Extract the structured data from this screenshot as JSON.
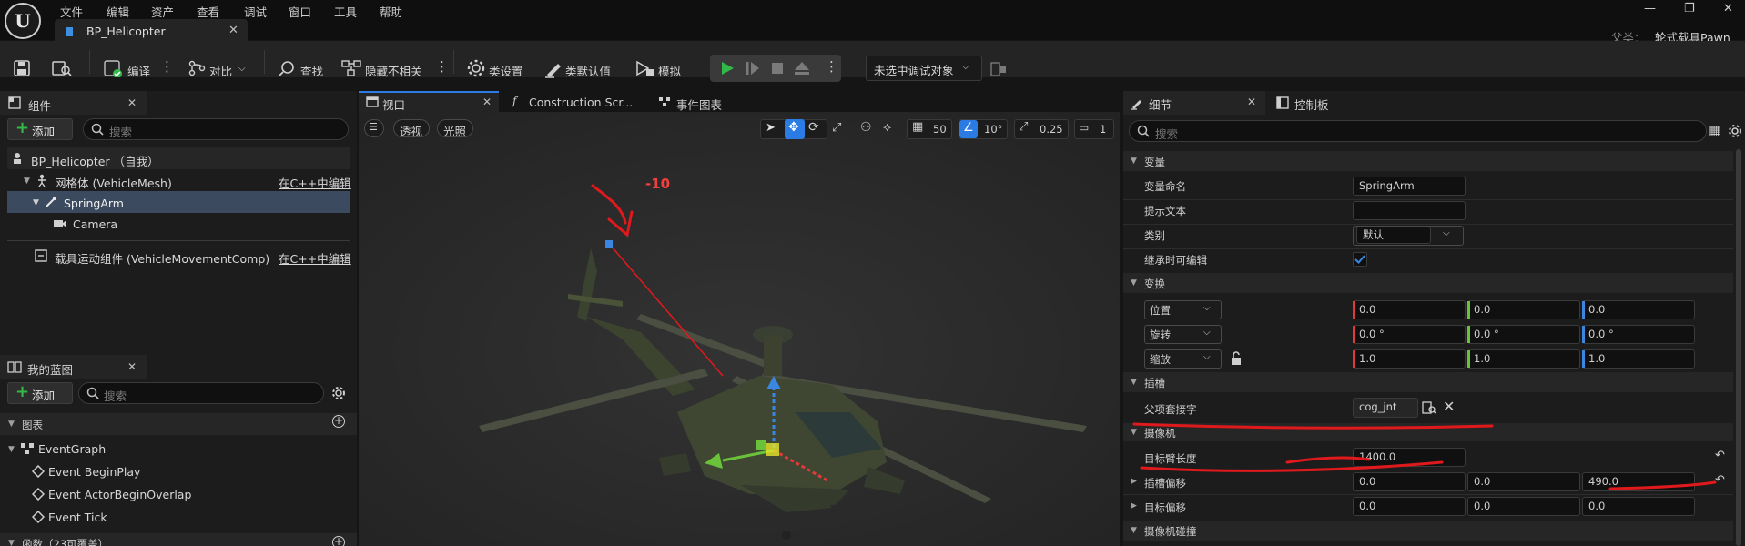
{
  "app": {
    "menu": [
      "文件",
      "编辑",
      "资产",
      "查看",
      "调试",
      "窗口",
      "工具",
      "帮助"
    ],
    "tab_title": "BP_Helicopter",
    "tab_close": "✕",
    "parent_label": "父类：",
    "parent_value": "轮式载具Pawn",
    "window_controls": [
      "—",
      "❐",
      "✕"
    ]
  },
  "toolbar": {
    "compile": "编译",
    "diff": "对比",
    "find": "查找",
    "hide_unrelated": "隐藏不相关",
    "class_settings": "类设置",
    "class_defaults": "类默认值",
    "simulate": "模拟",
    "debug_target": "未选中调试对象"
  },
  "components_panel": {
    "title": "组件",
    "add": "添加",
    "search_placeholder": "搜索",
    "items": [
      {
        "label": "BP_Helicopter （自我）"
      },
      {
        "label": "网格体 (VehicleMesh)",
        "link": "在C++中编辑"
      },
      {
        "label": "SpringArm"
      },
      {
        "label": "Camera"
      },
      {
        "label": "载具运动组件 (VehicleMovementComp)",
        "link": "在C++中编辑"
      }
    ]
  },
  "blueprint_panel": {
    "title": "我的蓝图",
    "add": "添加",
    "search_placeholder": "搜索",
    "graphs_header": "图表",
    "event_graph": "EventGraph",
    "events": [
      "Event BeginPlay",
      "Event ActorBeginOverlap",
      "Event Tick"
    ],
    "functions_header": "函数（23可覆盖）"
  },
  "viewport": {
    "tabs": [
      "视口",
      "Construction Scr...",
      "事件图表"
    ],
    "perspective": "透视",
    "lit": "光照",
    "grid_snap": "50",
    "rot_snap": "10°",
    "scale_snap": "0.25",
    "cam_speed": "1",
    "annotation": "-10"
  },
  "details": {
    "tabs": [
      "细节",
      "控制板"
    ],
    "search_placeholder": "搜索",
    "variable_section": "变量",
    "var_name_label": "变量命名",
    "var_name_value": "SpringArm",
    "tooltip_label": "提示文本",
    "tooltip_value": "",
    "category_label": "类别",
    "category_value": "默认",
    "editable_label": "继承时可编辑",
    "transform_section": "变换",
    "location_label": "位置",
    "location": [
      "0.0",
      "0.0",
      "0.0"
    ],
    "rotation_label": "旋转",
    "rotation": [
      "0.0 °",
      "0.0 °",
      "0.0 °"
    ],
    "scale_label": "缩放",
    "scale": [
      "1.0",
      "1.0",
      "1.0"
    ],
    "socket_section": "插槽",
    "parent_socket_label": "父项套接字",
    "parent_socket_value": "cog_jnt",
    "camera_section": "摄像机",
    "arm_length_label": "目标臂长度",
    "arm_length_value": "1400.0",
    "socket_offset_label": "插槽偏移",
    "socket_offset": [
      "0.0",
      "0.0",
      "490.0"
    ],
    "target_offset_label": "目标偏移",
    "target_offset": [
      "0.0",
      "0.0",
      "0.0"
    ],
    "camera_collision_section": "摄像机碰撞"
  },
  "colors": {
    "accent_blue": "#2a7be4",
    "play_green": "#32b94a",
    "annotation_red": "#e0191c",
    "x_red": "#e03a3a",
    "y_green": "#6ac23a",
    "z_blue": "#3a86e0"
  }
}
